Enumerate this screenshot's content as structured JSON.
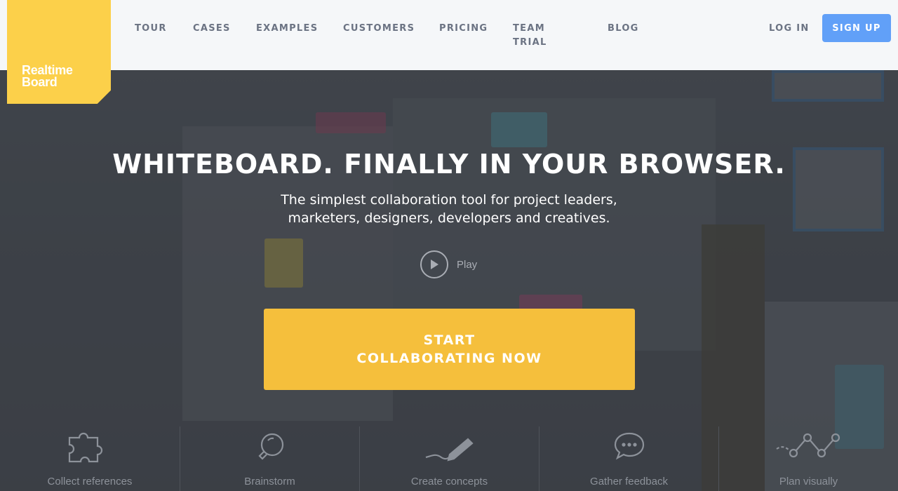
{
  "logo": {
    "text_line1": "Realtime",
    "text_line2": "Board"
  },
  "nav": {
    "tour": "TOUR",
    "cases": "CASES",
    "examples": "EXAMPLES",
    "customers": "CUSTOMERS",
    "pricing": "PRICING",
    "team_trial_line1": "TEAM",
    "team_trial_line2": "TRIAL",
    "blog": "BLOG",
    "login": "LOG IN",
    "signup": "SIGN UP"
  },
  "hero": {
    "headline": "WHITEBOARD. FINALLY IN YOUR BROWSER.",
    "subline_line1": "The simplest collaboration tool for project leaders,",
    "subline_line2": "marketers, designers, developers and creatives.",
    "play_label": "Play",
    "cta_label": "START COLLABORATING NOW"
  },
  "features": [
    {
      "label": "Collect references",
      "icon": "puzzle-icon"
    },
    {
      "label": "Brainstorm",
      "icon": "lightbulb-icon"
    },
    {
      "label": "Create concepts",
      "icon": "pen-icon"
    },
    {
      "label": "Gather feedback",
      "icon": "speech-bubble-icon"
    },
    {
      "label": "Plan visually",
      "icon": "timeline-icon"
    }
  ],
  "colors": {
    "brand_yellow": "#fcd04a",
    "cta_yellow": "#f5bf3c",
    "signup_blue": "#61a0f8",
    "nav_text": "#6b7383"
  }
}
